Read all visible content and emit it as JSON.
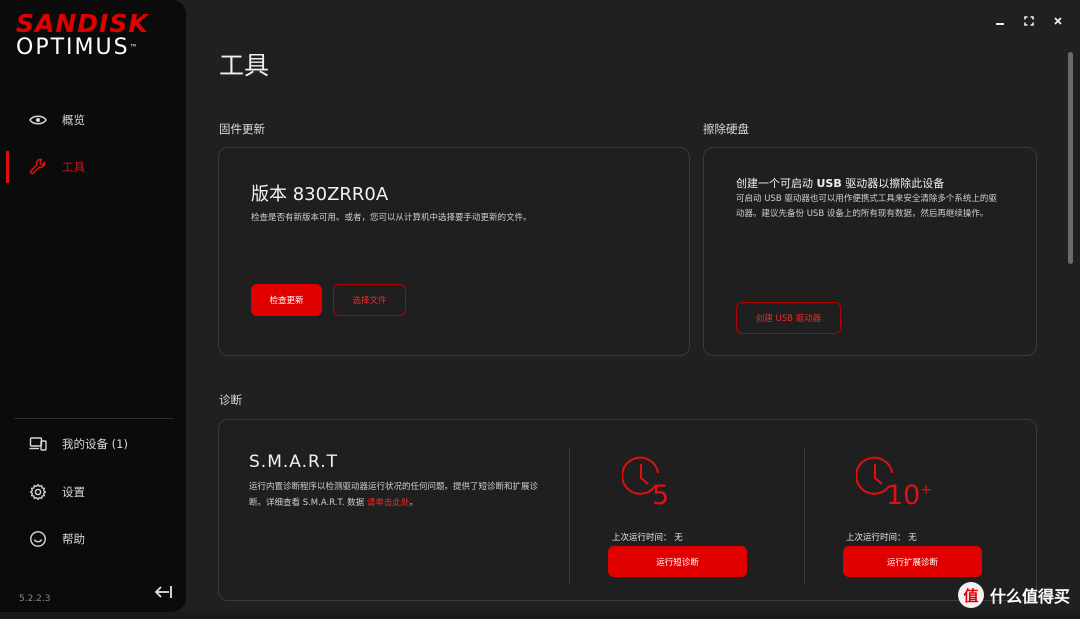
{
  "brand": {
    "line1": "SANDISK",
    "line2": "OPTIMUS",
    "tm": "™"
  },
  "nav": {
    "overview": "概览",
    "tools": "工具",
    "my_devices": "我的设备 (1)",
    "settings": "设置",
    "help": "帮助"
  },
  "version": "5.2.2.3",
  "page": {
    "title": "工具"
  },
  "firmware": {
    "section": "固件更新",
    "version_title": "版本 830ZRR0A",
    "desc": "检查是否有新版本可用。或者，您可以从计算机中选择要手动更新的文件。",
    "check_button": "检查更新",
    "select_button": "选择文件"
  },
  "wipe": {
    "section": "擦除硬盘",
    "title_pre": "创建一个可启动 ",
    "title_bold": "USB",
    "title_post": " 驱动器以擦除此设备",
    "desc": "可启动 USB 驱动器也可以用作便携式工具来安全清除多个系统上的驱动器。建议先备份 USB 设备上的所有现有数据，然后再继续操作。",
    "create_button": "创建 USB 驱动器"
  },
  "diagnostics": {
    "section": "诊断",
    "smart_title": "S.M.A.R.T",
    "desc": "运行内置诊断程序以检测驱动器运行状况的任何问题。提供了短诊断和扩展诊断。详细查看 S.M.A.R.T. 数据 ",
    "link": "请单击此处",
    "desc_end": "。",
    "short": {
      "minutes": "5",
      "last_run": "上次运行时间：  无",
      "button": "运行短诊断"
    },
    "extended": {
      "minutes": "10",
      "plus": "+",
      "last_run": "上次运行时间：  无",
      "button": "运行扩展诊断"
    }
  },
  "watermark": {
    "badge": "值",
    "text": "什么值得买"
  },
  "colors": {
    "accent": "#e10000",
    "sidebar": "#0b0b0b",
    "background": "#202020"
  }
}
